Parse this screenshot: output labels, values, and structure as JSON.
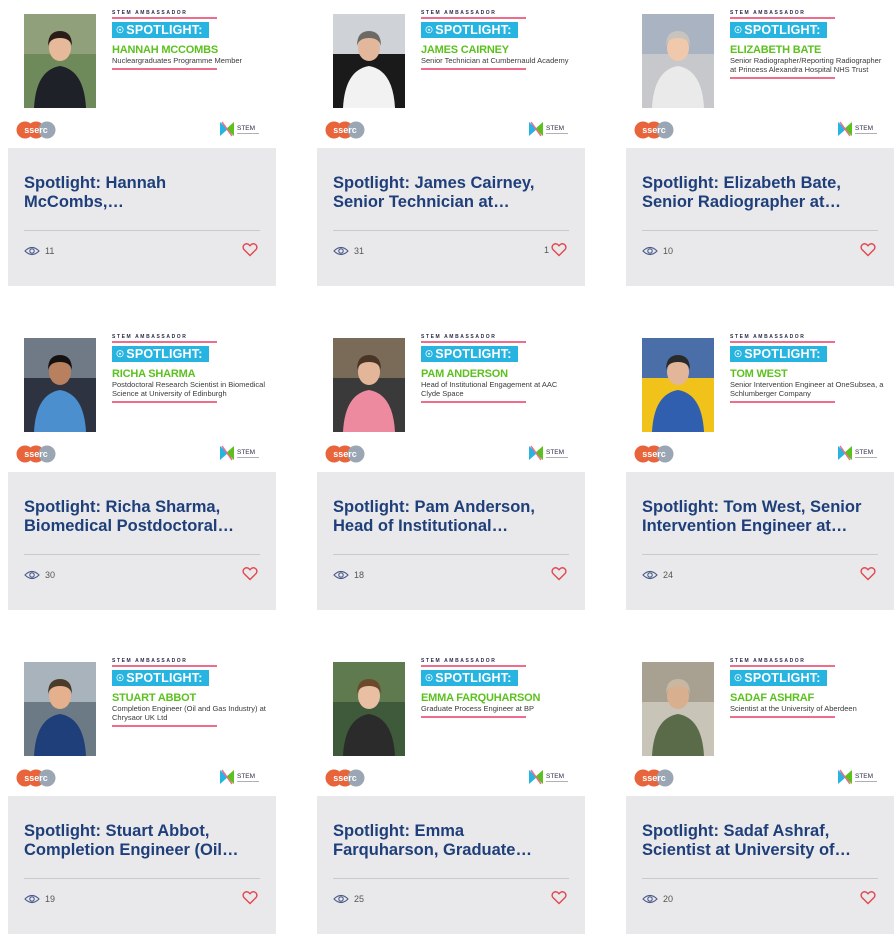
{
  "colors": {
    "title": "#1f3f7a",
    "spotlight_bg": "#27b4e0",
    "name": "#5cc11f",
    "accent_line": "#ee6c8c",
    "card_bg": "#e9e9eb",
    "heart": "#e0484f"
  },
  "banner": {
    "ambassador_label": "STEM AMBASSADOR",
    "spotlight_label": "SPOTLIGHT:",
    "logo_left": "sserc",
    "logo_right": "STEM"
  },
  "posts": [
    {
      "name": "HANNAH MCCOMBS",
      "role": "Nucleargraduates Programme Member",
      "title": "Spotlight: Hannah McCombs,…",
      "views": "11",
      "likes": ""
    },
    {
      "name": "JAMES CAIRNEY",
      "role": "Senior Technician at Cumbernauld Academy",
      "title": "Spotlight: James Cairney, Senior Technician at…",
      "views": "31",
      "likes": "1"
    },
    {
      "name": "ELIZABETH BATE",
      "role": "Senior Radiographer/Reporting Radiographer at Princess Alexandra Hospital NHS Trust",
      "title": "Spotlight: Elizabeth Bate, Senior Radiographer at…",
      "views": "10",
      "likes": ""
    },
    {
      "name": "RICHA SHARMA",
      "role": "Postdoctoral Research Scientist in Biomedical Science at University of Edinburgh",
      "title": "Spotlight: Richa Sharma, Biomedical Postdoctoral…",
      "views": "30",
      "likes": ""
    },
    {
      "name": "PAM ANDERSON",
      "role": "Head of Institutional Engagement at AAC Clyde Space",
      "title": "Spotlight: Pam Anderson, Head of Institutional…",
      "views": "18",
      "likes": ""
    },
    {
      "name": "TOM WEST",
      "role": "Senior Intervention Engineer at OneSubsea, a Schlumberger Company",
      "title": "Spotlight: Tom West, Senior Intervention Engineer at…",
      "views": "24",
      "likes": ""
    },
    {
      "name": "STUART ABBOT",
      "role": "Completion Engineer (Oil and Gas Industry) at Chrysaor UK Ltd",
      "title": "Spotlight: Stuart Abbot, Completion Engineer (Oil…",
      "views": "19",
      "likes": ""
    },
    {
      "name": "EMMA FARQUHARSON",
      "role": "Graduate Process Engineer at BP",
      "title": "Spotlight: Emma Farquharson, Graduate…",
      "views": "25",
      "likes": ""
    },
    {
      "name": "SADAF ASHRAF",
      "role": "Scientist at the University of Aberdeen",
      "title": "Spotlight: Sadaf Ashraf, Scientist at University of…",
      "views": "20",
      "likes": ""
    }
  ]
}
